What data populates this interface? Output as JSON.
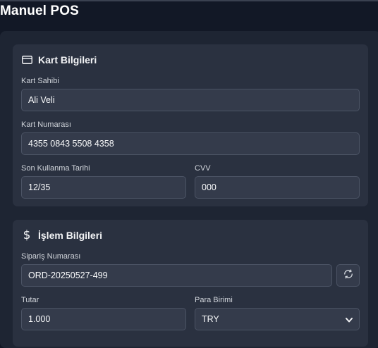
{
  "page": {
    "title": "Manuel POS"
  },
  "card_info": {
    "title": "Kart Bilgileri",
    "holder_label": "Kart Sahibi",
    "holder_value": "Ali Veli",
    "number_label": "Kart Numarası",
    "number_value": "4355 0843 5508 4358",
    "expiry_label": "Son Kullanma Tarihi",
    "expiry_value": "12/35",
    "cvv_label": "CVV",
    "cvv_value": "000"
  },
  "transaction": {
    "title": "İşlem Bilgileri",
    "order_label": "Sipariş Numarası",
    "order_value": "ORD-20250527-499",
    "amount_label": "Tutar",
    "amount_value": "1.000",
    "currency_label": "Para Birimi",
    "currency_value": "TRY"
  },
  "icons": {
    "card": "credit-card-icon",
    "currency": "dollar-icon",
    "refresh": "refresh-icon",
    "chevron": "chevron-down-icon"
  }
}
